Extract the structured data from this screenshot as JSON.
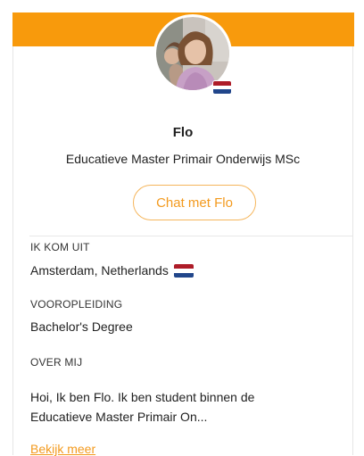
{
  "profile": {
    "name": "Flo",
    "program": "Educatieve Master Primair Onderwijs MSc",
    "avatar_icon": "student-portrait",
    "flag_icon": "netherlands-flag"
  },
  "actions": {
    "chat_label": "Chat met Flo"
  },
  "details": {
    "origin_label": "IK KOM UIT",
    "origin_value": "Amsterdam, Netherlands",
    "education_label": "VOOROPLEIDING",
    "education_value": "Bachelor's Degree",
    "about_label": "OVER MIJ",
    "about_line_1": "Hoi, Ik ben Flo. Ik ben student binnen de",
    "about_line_2": "Educatieve Master Primair On...",
    "more_link": "Bekijk meer"
  },
  "colors": {
    "accent": "#f89a0c",
    "flag_red": "#ae1c28",
    "flag_white": "#ffffff",
    "flag_blue": "#21468b"
  }
}
